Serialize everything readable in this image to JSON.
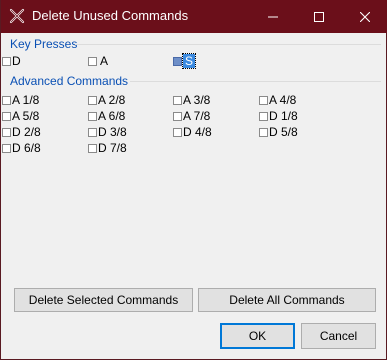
{
  "window": {
    "title": "Delete Unused Commands",
    "icons": {
      "app": "crossed-tools-icon",
      "minimize": "minimize-icon",
      "maximize": "maximize-icon",
      "close": "close-icon"
    },
    "titlebar_color": "#6b0f1a"
  },
  "key_presses": {
    "label": "Key Presses",
    "items": [
      {
        "label": "D",
        "checked": false
      },
      {
        "label": "A",
        "checked": false
      },
      {
        "label": "S",
        "checked": true,
        "focused": true
      }
    ]
  },
  "advanced": {
    "label": "Advanced Commands",
    "items": [
      {
        "label": "A 1/8",
        "checked": false
      },
      {
        "label": "A 2/8",
        "checked": false
      },
      {
        "label": "A 3/8",
        "checked": false
      },
      {
        "label": "A 4/8",
        "checked": false
      },
      {
        "label": "A 5/8",
        "checked": false
      },
      {
        "label": "A 6/8",
        "checked": false
      },
      {
        "label": "A 7/8",
        "checked": false
      },
      {
        "label": "D 1/8",
        "checked": false
      },
      {
        "label": "D 2/8",
        "checked": false
      },
      {
        "label": "D 3/8",
        "checked": false
      },
      {
        "label": "D 4/8",
        "checked": false
      },
      {
        "label": "D 5/8",
        "checked": false
      },
      {
        "label": "D 6/8",
        "checked": false
      },
      {
        "label": "D 7/8",
        "checked": false
      }
    ]
  },
  "buttons": {
    "delete_selected": "Delete Selected Commands",
    "delete_all": "Delete All Commands",
    "ok": "OK",
    "cancel": "Cancel"
  }
}
